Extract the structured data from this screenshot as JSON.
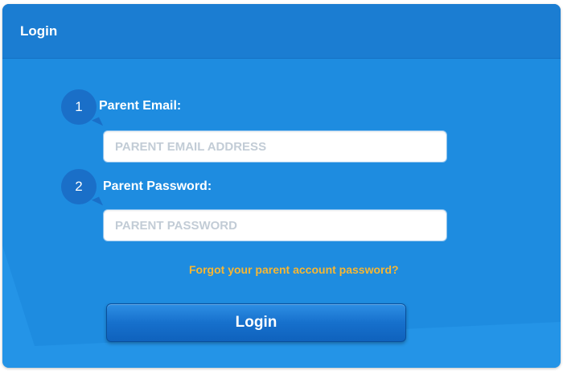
{
  "header": {
    "title": "Login"
  },
  "form": {
    "email": {
      "step": "1",
      "label": "Parent Email:",
      "placeholder": "PARENT EMAIL ADDRESS",
      "value": ""
    },
    "password": {
      "step": "2",
      "label": "Parent Password:",
      "placeholder": "PARENT PASSWORD",
      "value": ""
    },
    "forgot_link": "Forgot your parent account password?",
    "submit_label": "Login"
  },
  "colors": {
    "panel_background": "#1e8ce0",
    "header_background": "#1b7dd2",
    "step_bubble": "#1a6fc8",
    "link": "#f7b733",
    "button": "#1670cc"
  },
  "icons": {
    "step_bubble_shape": "speech-bubble"
  }
}
